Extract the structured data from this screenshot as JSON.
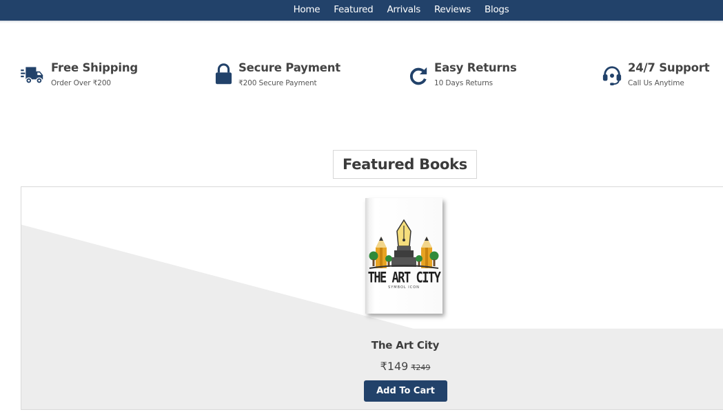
{
  "nav": {
    "links": [
      "Home",
      "Featured",
      "Arrivals",
      "Reviews",
      "Blogs"
    ]
  },
  "features": [
    {
      "icon": "shipping-truck-icon",
      "title": "Free Shipping",
      "subtitle": "Order Over ₹200"
    },
    {
      "icon": "lock-icon",
      "title": "Secure Payment",
      "subtitle": "₹200 Secure Payment"
    },
    {
      "icon": "redo-icon",
      "title": "Easy Returns",
      "subtitle": "10 Days Returns"
    },
    {
      "icon": "headset-icon",
      "title": "24/7 Support",
      "subtitle": "Call Us Anytime"
    }
  ],
  "section": {
    "title": "Featured Books"
  },
  "product": {
    "cover_title": "THE ART CITY",
    "cover_subtitle": "SYMBOL ICON",
    "name": "The Art City",
    "price": "₹149",
    "old_price": "₹249",
    "button_label": "Add To Cart"
  },
  "colors": {
    "brand": "#22426a",
    "card_shade": "#ededed",
    "text": "#444444"
  }
}
